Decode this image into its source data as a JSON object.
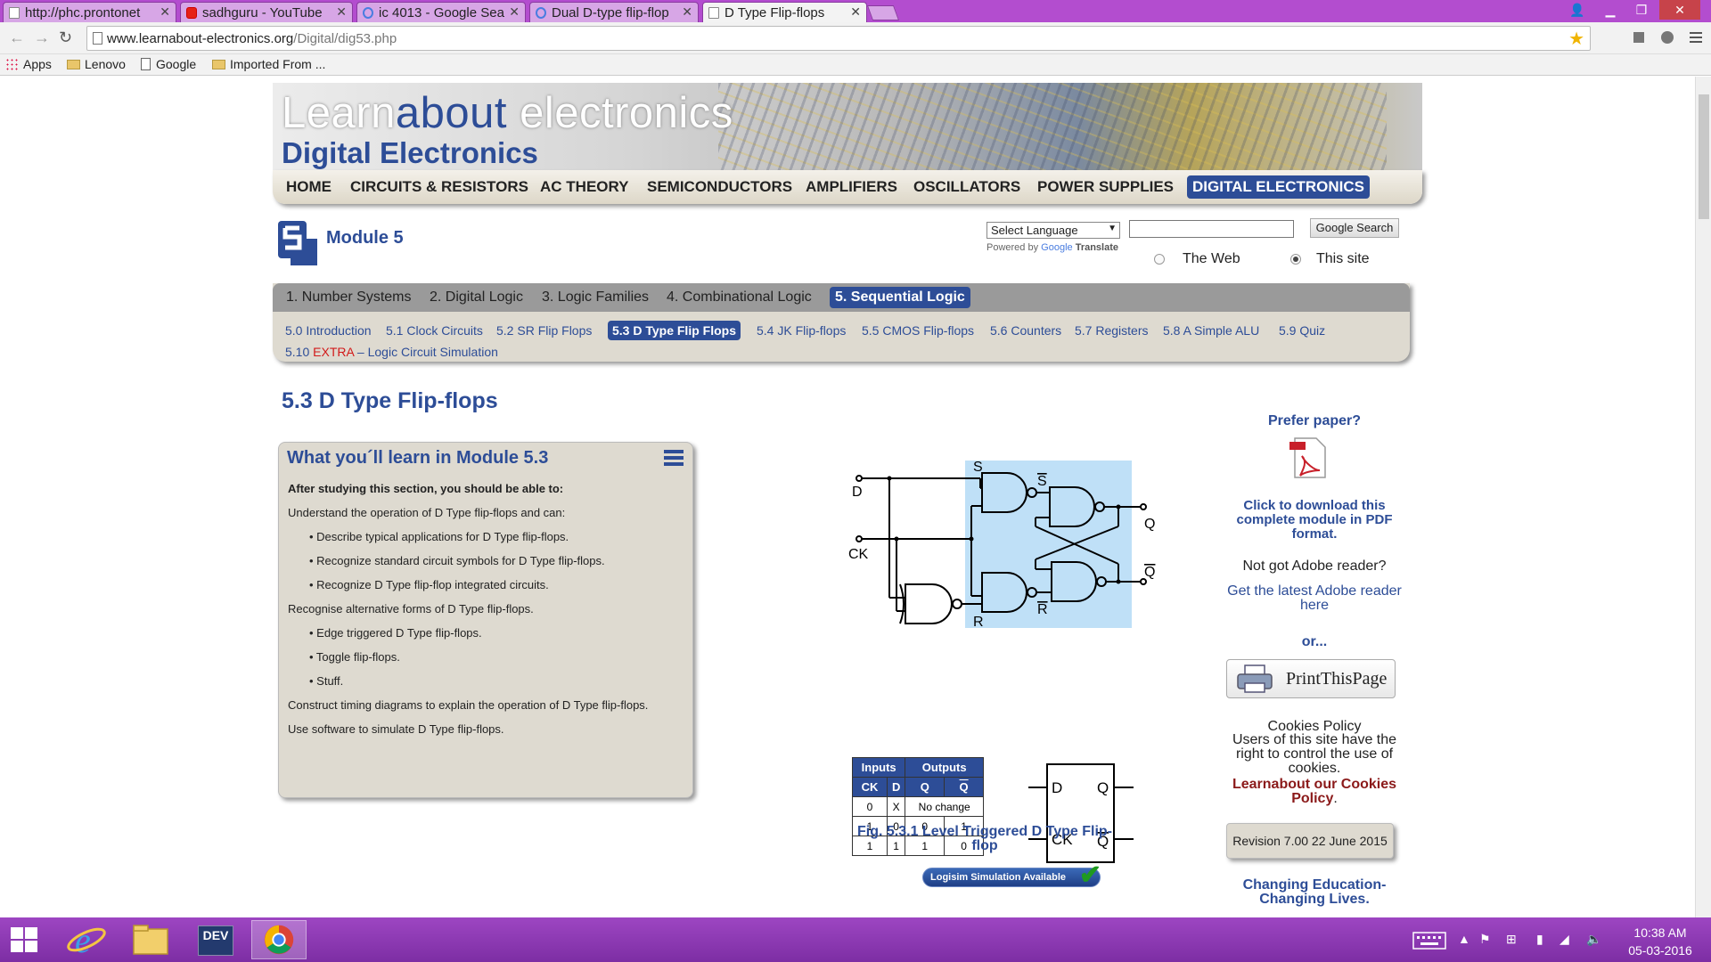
{
  "browser": {
    "tabs": [
      {
        "label": "http://phc.prontonet",
        "icon": "page-icon"
      },
      {
        "label": "sadhguru - YouTube",
        "icon": "youtube-icon"
      },
      {
        "label": "ic 4013 - Google Sea",
        "icon": "google-icon"
      },
      {
        "label": "Dual D-type flip-flop",
        "icon": "google-icon"
      },
      {
        "label": "D Type Flip-flops",
        "icon": "page-icon",
        "active": true
      }
    ],
    "url_host": "www.learnabout-electronics.org",
    "url_path": "/Digital/dig53.php",
    "bookmarks": [
      "Apps",
      "Lenovo",
      "Google",
      "Imported From ..."
    ]
  },
  "site": {
    "title_learn": "Learn",
    "title_about": "about",
    "title_electronics": " electronics",
    "subtitle": "Digital Electronics",
    "nav": [
      "HOME",
      "CIRCUITS & RESISTORS",
      "AC THEORY",
      "SEMICONDUCTORS",
      "AMPLIFIERS",
      "OSCILLATORS",
      "POWER SUPPLIES",
      "DIGITAL ELECTRONICS"
    ],
    "nav_active": "DIGITAL ELECTRONICS"
  },
  "module": {
    "title": "Module 5",
    "tabs": [
      "1. Number Systems",
      "2. Digital Logic",
      "3. Logic Families",
      "4. Combinational Logic",
      "5. Sequential Logic"
    ],
    "sublinks": [
      "5.0 Introduction",
      "5.1 Clock Circuits",
      "5.2 SR Flip Flops",
      "5.3 D Type Flip Flops",
      "5.4 JK Flip-flops",
      "5.5 CMOS Flip-flops",
      "5.6 Counters",
      "5.7 Registers",
      "5.8 A Simple ALU",
      "5.9 Quiz"
    ],
    "extra_prefix": "5.10 ",
    "extra_red": "EXTRA",
    "extra_rest": " – Logic Circuit Simulation"
  },
  "search": {
    "language_select": "Select Language",
    "powered_prefix": "Powered by",
    "powered_google": "Google",
    "powered_translate": "Translate",
    "button": "Google Search",
    "option_web": "The Web",
    "option_site": "This site"
  },
  "page": {
    "title": "5.3 D Type Flip-flops",
    "learn_title": "What you´ll learn in Module 5.3",
    "learn_lines": [
      "After studying this section, you should be able to:",
      "Understand the operation of D Type flip-flops and can:",
      "• Describe typical applications for D Type flip-flops.",
      "• Recognize standard circuit symbols for D Type flip-flops.",
      "• Recognize D Type flip-flop integrated circuits.",
      "Recognise alternative forms of D Type flip-flops.",
      "• Edge triggered D Type flip-flops.",
      "• Toggle flip-flops.",
      "• Stuff.",
      "Construct timing diagrams to explain the operation of D Type flip-flops.",
      "Use software to simulate D Type flip-flops."
    ],
    "figure_labels": {
      "d": "D",
      "ck": "CK",
      "s": "S",
      "s_bar": "S",
      "r": "R",
      "r_bar": "R",
      "q": "Q",
      "q_bar": "Q"
    },
    "truth_table": {
      "group_headers": [
        "Inputs",
        "Outputs"
      ],
      "headers": [
        "CK",
        "D",
        "Q",
        "Q"
      ],
      "rows": [
        [
          "0",
          "X",
          "No change"
        ],
        [
          "1",
          "0",
          "0",
          "1"
        ],
        [
          "1",
          "1",
          "1",
          "0"
        ]
      ]
    },
    "symbol_labels": {
      "d": "D",
      "q": "Q",
      "ck": "CK",
      "q_bar": "Q"
    },
    "caption": "Fig. 5.3.1 Level Triggered D Type Flip-flop",
    "logisim": "Logisim Simulation Available"
  },
  "sidebar": {
    "prefer": "Prefer paper?",
    "download": "Click to download this complete module in PDF format.",
    "adobe_q": "Not got Adobe reader?",
    "adobe_link": "Get the latest Adobe reader here",
    "or": "or...",
    "print": "PrintThisPage",
    "cookies_title": "Cookies Policy",
    "cookies_text": "Users of this site have the right to control the use of cookies.",
    "cookies_link": "Learnabout our Cookies Policy",
    "cookies_end": ".",
    "revision": "Revision 7.00 22 June 2015",
    "motto": "Changing Education- Changing Lives."
  },
  "taskbar": {
    "time": "10:38 AM",
    "date": "05-03-2016",
    "dev_label": "DEV"
  },
  "colors": {
    "brand": "#2d4d97",
    "taskbar": "#8a37b3",
    "highlight_red": "#d21a1a"
  }
}
